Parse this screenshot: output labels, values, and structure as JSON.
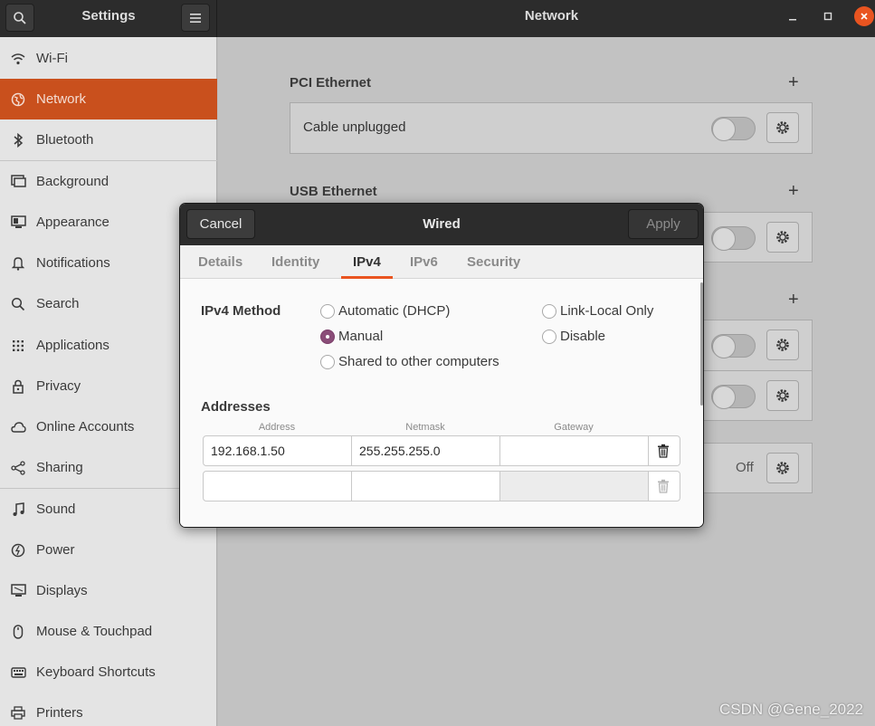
{
  "header": {
    "settings_title": "Settings",
    "window_title": "Network"
  },
  "sidebar": {
    "items": [
      {
        "label": "Wi-Fi",
        "icon": "wifi-icon"
      },
      {
        "label": "Network",
        "icon": "network-icon",
        "active": true
      },
      {
        "label": "Bluetooth",
        "icon": "bluetooth-icon"
      },
      {
        "label": "Background",
        "icon": "background-icon"
      },
      {
        "label": "Appearance",
        "icon": "appearance-icon"
      },
      {
        "label": "Notifications",
        "icon": "bell-icon"
      },
      {
        "label": "Search",
        "icon": "search-icon"
      },
      {
        "label": "Applications",
        "icon": "grid-icon"
      },
      {
        "label": "Privacy",
        "icon": "lock-icon"
      },
      {
        "label": "Online Accounts",
        "icon": "cloud-icon"
      },
      {
        "label": "Sharing",
        "icon": "share-icon"
      },
      {
        "label": "Sound",
        "icon": "music-note-icon"
      },
      {
        "label": "Power",
        "icon": "power-icon"
      },
      {
        "label": "Displays",
        "icon": "display-icon"
      },
      {
        "label": "Mouse & Touchpad",
        "icon": "mouse-icon"
      },
      {
        "label": "Keyboard Shortcuts",
        "icon": "keyboard-icon"
      },
      {
        "label": "Printers",
        "icon": "printer-icon"
      }
    ]
  },
  "main": {
    "pci_title": "PCI Ethernet",
    "pci_status": "Cable unplugged",
    "usb_title": "USB Ethernet",
    "vpn_status": "Off"
  },
  "dialog": {
    "cancel_label": "Cancel",
    "title": "Wired",
    "apply_label": "Apply",
    "tabs": [
      "Details",
      "Identity",
      "IPv4",
      "IPv6",
      "Security"
    ],
    "active_tab": "IPv4",
    "method_label": "IPv4 Method",
    "methods": {
      "automatic": "Automatic (DHCP)",
      "link_local": "Link-Local Only",
      "manual": "Manual",
      "disable": "Disable",
      "shared": "Shared to other computers"
    },
    "selected_method": "Manual",
    "addresses_label": "Addresses",
    "columns": {
      "address": "Address",
      "netmask": "Netmask",
      "gateway": "Gateway"
    },
    "rows": [
      {
        "address": "192.168.1.50",
        "netmask": "255.255.255.0",
        "gateway": ""
      },
      {
        "address": "",
        "netmask": "",
        "gateway": ""
      }
    ]
  },
  "watermark": "CSDN @Gene_2022"
}
